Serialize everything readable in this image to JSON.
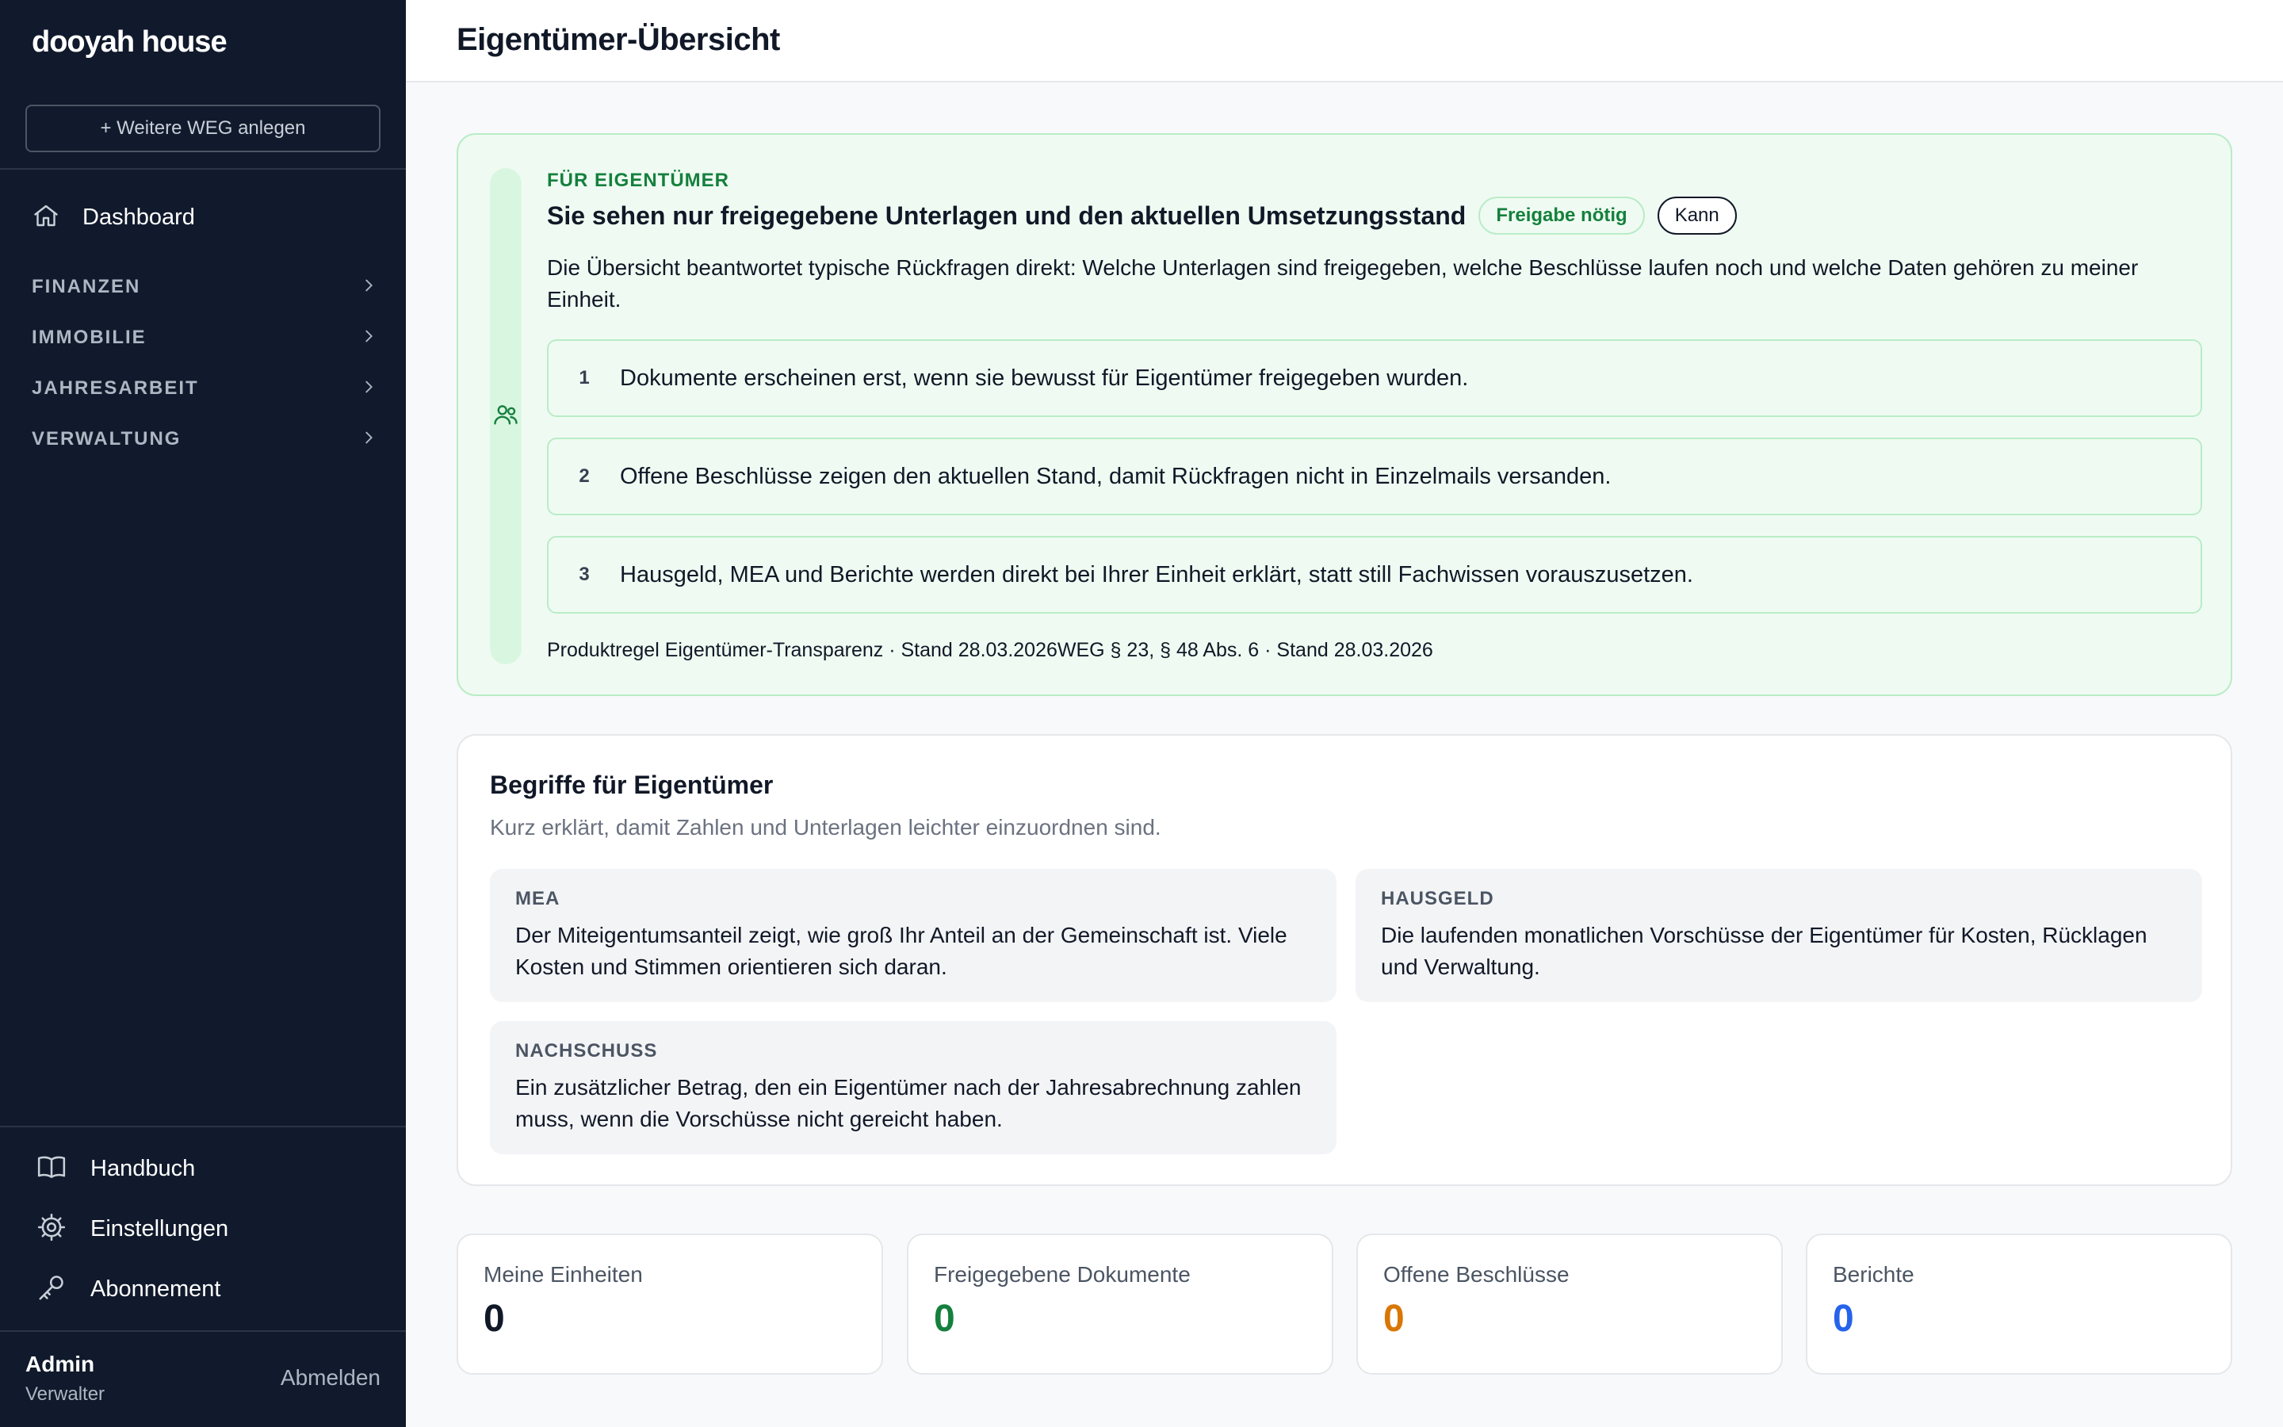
{
  "app": {
    "brand": "dooyah house"
  },
  "sidebar": {
    "add_weg_label": "+ Weitere WEG anlegen",
    "dashboard_label": "Dashboard",
    "sections": [
      {
        "label": "FINANZEN"
      },
      {
        "label": "IMMOBILIE"
      },
      {
        "label": "JAHRESARBEIT"
      },
      {
        "label": "VERWALTUNG"
      }
    ],
    "bottom": [
      {
        "label": "Handbuch",
        "icon": "book-icon"
      },
      {
        "label": "Einstellungen",
        "icon": "gear-icon"
      },
      {
        "label": "Abonnement",
        "icon": "key-icon"
      }
    ],
    "user": {
      "name": "Admin",
      "role": "Verwalter",
      "logout_label": "Abmelden"
    }
  },
  "header": {
    "title": "Eigentümer-Übersicht"
  },
  "owner_info": {
    "eyebrow": "FÜR EIGENTÜMER",
    "title": "Sie sehen nur freigegebene Unterlagen und den aktuellen Umsetzungsstand",
    "badge_release": "Freigabe nötig",
    "badge_can": "Kann",
    "description": "Die Übersicht beantwortet typische Rückfragen direkt: Welche Unterlagen sind freigegeben, welche Beschlüsse laufen noch und welche Daten gehören zu meiner Einheit.",
    "steps": [
      {
        "num": "1",
        "text": "Dokumente erscheinen erst, wenn sie bewusst für Eigentümer freigegeben wurden."
      },
      {
        "num": "2",
        "text": "Offene Beschlüsse zeigen den aktuellen Stand, damit Rückfragen nicht in Einzelmails versanden."
      },
      {
        "num": "3",
        "text": "Hausgeld, MEA und Berichte werden direkt bei Ihrer Einheit erklärt, statt still Fachwissen vorauszusetzen."
      }
    ],
    "footer": "Produktregel Eigentümer-Transparenz · Stand 28.03.2026WEG § 23, § 48 Abs. 6 · Stand 28.03.2026"
  },
  "glossary": {
    "title": "Begriffe für Eigentümer",
    "subtitle": "Kurz erklärt, damit Zahlen und Unterlagen leichter einzuordnen sind.",
    "terms": [
      {
        "key": "MEA",
        "text": "Der Miteigentumsanteil zeigt, wie groß Ihr Anteil an der Gemeinschaft ist. Viele Kosten und Stimmen orientieren sich daran."
      },
      {
        "key": "HAUSGELD",
        "text": "Die laufenden monatlichen Vorschüsse der Eigentümer für Kosten, Rücklagen und Verwaltung."
      },
      {
        "key": "NACHSCHUSS",
        "text": "Ein zusätzlicher Betrag, den ein Eigentümer nach der Jahresabrechnung zahlen muss, wenn die Vorschüsse nicht gereicht haben."
      }
    ]
  },
  "stats": [
    {
      "label": "Meine Einheiten",
      "value": "0",
      "color": "#111827"
    },
    {
      "label": "Freigegebene Dokumente",
      "value": "0",
      "color": "#15803d"
    },
    {
      "label": "Offene Beschlüsse",
      "value": "0",
      "color": "#d97706"
    },
    {
      "label": "Berichte",
      "value": "0",
      "color": "#2563eb"
    }
  ],
  "colors": {
    "sidebar_bg": "#111a2c",
    "accent_green": "#15803d",
    "info_bg": "#effbf2"
  }
}
